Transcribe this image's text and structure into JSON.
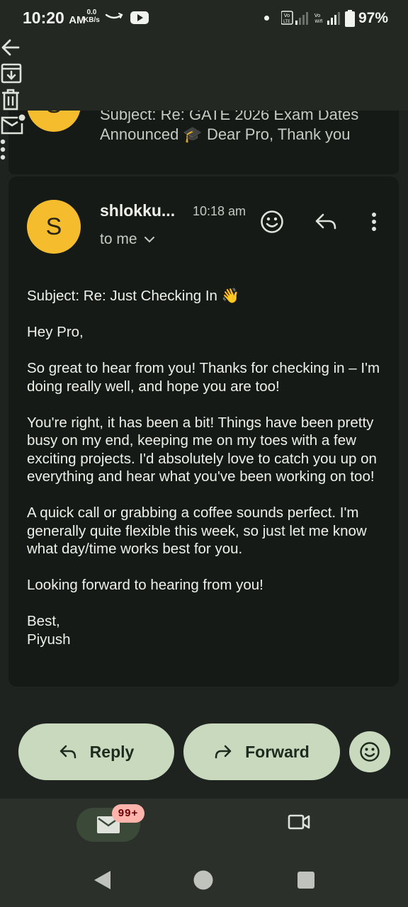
{
  "status_bar": {
    "time": "10:20",
    "meridiem": "AM",
    "net_speed_value": "0.0",
    "net_speed_unit": "KB/s",
    "battery": "97%"
  },
  "app_bar": {
    "back_icon": "arrow-left-icon",
    "archive_icon": "archive-icon",
    "delete_icon": "trash-icon",
    "mark_unread_icon": "mail-unread-icon",
    "more_icon": "more-vert-icon"
  },
  "collapsed_message": {
    "avatar_letter": "S",
    "snippet": "Subject: Re: GATE 2026 Exam Dates Announced 🎓 Dear Pro, Thank you"
  },
  "message": {
    "avatar_letter": "S",
    "sender": "shlokku...",
    "time": "10:18 am",
    "recipient": "to me",
    "body": [
      "Subject: Re: Just Checking In 👋",
      "Hey Pro,",
      "So great to hear from you! Thanks for checking in – I'm doing really well, and hope you are too!",
      "You're right, it has been a bit! Things have been pretty busy on my end, keeping me on my toes with a few exciting projects. I'd absolutely love to catch you up on everything and hear what you've been working on too!",
      "A quick call or grabbing a coffee sounds perfect. I'm generally quite flexible this week, so just let me know what day/time works best for you.",
      "Looking forward to hearing from you!",
      "Best,\nPiyush"
    ]
  },
  "actions": {
    "reply": "Reply",
    "forward": "Forward"
  },
  "tab_bar": {
    "mail_badge": "99+"
  },
  "colors": {
    "avatar": "#f5bd2e",
    "pill": "#c9d9be",
    "badge": "#ffb4ab",
    "card": "#161a16"
  }
}
